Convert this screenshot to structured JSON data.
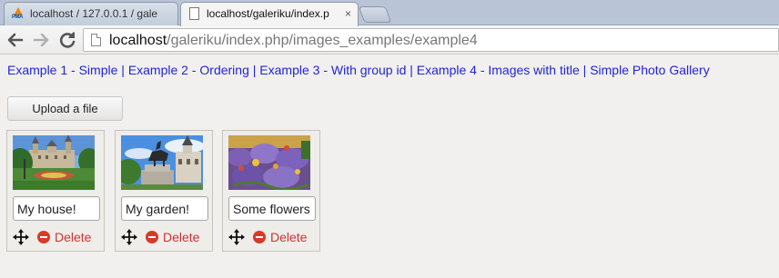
{
  "browser": {
    "tabs": [
      {
        "title": "localhost / 127.0.0.1 / gale",
        "active": false,
        "favicon": "phpmyadmin-icon"
      },
      {
        "title": "localhost/galeriku/index.p",
        "active": true,
        "favicon": "page-icon"
      }
    ],
    "pma_favicon_text": "PMA",
    "tab_close_glyph": "×",
    "url_host": "localhost",
    "url_path": "/galeriku/index.php/images_examples/example4"
  },
  "nav_links": [
    {
      "label": "Example 1 - Simple"
    },
    {
      "label": "Example 2 - Ordering"
    },
    {
      "label": "Example 3 - With group id"
    },
    {
      "label": "Example 4 - Images with title"
    },
    {
      "label": "Simple Photo Gallery"
    }
  ],
  "upload_button": {
    "label": "Upload a file"
  },
  "images": [
    {
      "title": "My house!",
      "thumbnail": "castle-photo",
      "delete_label": "Delete"
    },
    {
      "title": "My garden!",
      "thumbnail": "statue-photo",
      "delete_label": "Delete"
    },
    {
      "title": "Some flowers",
      "thumbnail": "flowers-photo",
      "delete_label": "Delete"
    }
  ],
  "colors": {
    "link": "#2424d6",
    "delete": "#cc3333",
    "page_background": "#f1f0ef"
  }
}
